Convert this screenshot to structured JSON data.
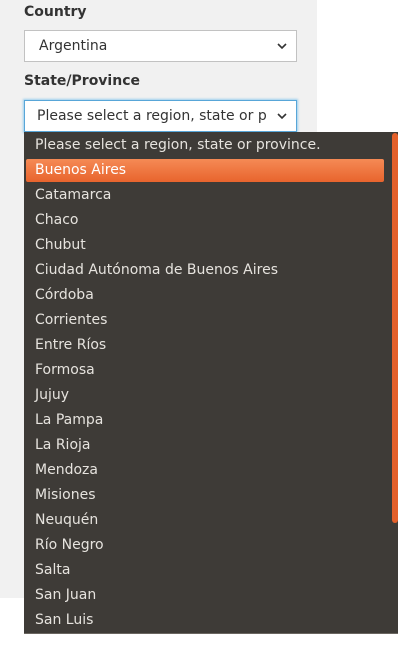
{
  "form": {
    "country_label": "Country",
    "country_value": "Argentina",
    "state_label": "State/Province",
    "state_value": "Please select a region, state or province."
  },
  "dropdown": {
    "selected_index": 1,
    "options": [
      "Please select a region, state or province.",
      "Buenos Aires",
      "Catamarca",
      "Chaco",
      "Chubut",
      "Ciudad Autónoma de Buenos Aires",
      "Córdoba",
      "Corrientes",
      "Entre Ríos",
      "Formosa",
      "Jujuy",
      "La Pampa",
      "La Rioja",
      "Mendoza",
      "Misiones",
      "Neuquén",
      "Río Negro",
      "Salta",
      "San Juan",
      "San Luis"
    ]
  },
  "colors": {
    "dropdown_bg": "#3e3b37",
    "highlight": "#ee7640",
    "scrollbar": "#e4602a",
    "focus_border": "#58a6d8"
  }
}
